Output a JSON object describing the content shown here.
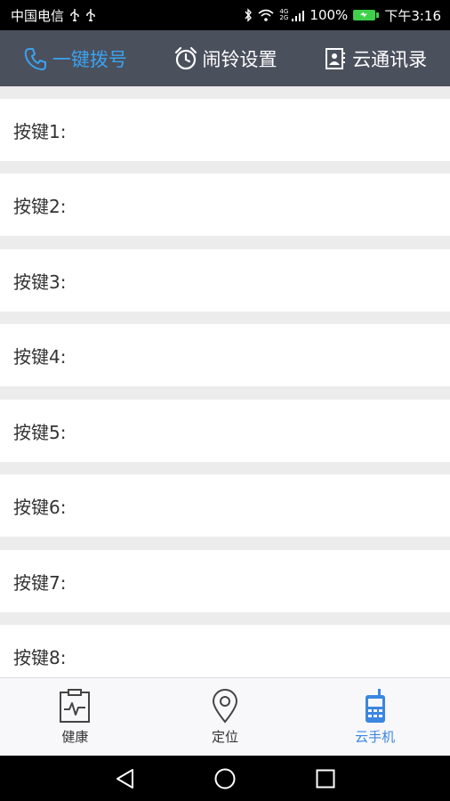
{
  "status_bar": {
    "carrier": "中国电信",
    "signal_label": "4G 2G",
    "battery_percent": "100%",
    "time": "下午3:16"
  },
  "top_tabs": [
    {
      "label": "一键拨号",
      "icon": "phone-icon",
      "active": true
    },
    {
      "label": "闹铃设置",
      "icon": "alarm-clock-icon",
      "active": false
    },
    {
      "label": "云通讯录",
      "icon": "contacts-icon",
      "active": false
    }
  ],
  "key_rows": [
    {
      "label": "按键1:"
    },
    {
      "label": "按键2:"
    },
    {
      "label": "按键3:"
    },
    {
      "label": "按键4:"
    },
    {
      "label": "按键5:"
    },
    {
      "label": "按键6:"
    },
    {
      "label": "按键7:"
    },
    {
      "label": "按键8:"
    }
  ],
  "bottom_nav": [
    {
      "label": "健康",
      "icon": "health-clipboard-icon",
      "active": false
    },
    {
      "label": "定位",
      "icon": "location-pin-icon",
      "active": false
    },
    {
      "label": "云手机",
      "icon": "cloud-phone-icon",
      "active": true
    }
  ],
  "colors": {
    "accent": "#3aa3ef",
    "nav_active": "#3b86e0",
    "topbar_bg": "#4b505d",
    "separator": "#ececec"
  },
  "system_nav": [
    "back-icon",
    "home-icon",
    "recents-icon"
  ]
}
